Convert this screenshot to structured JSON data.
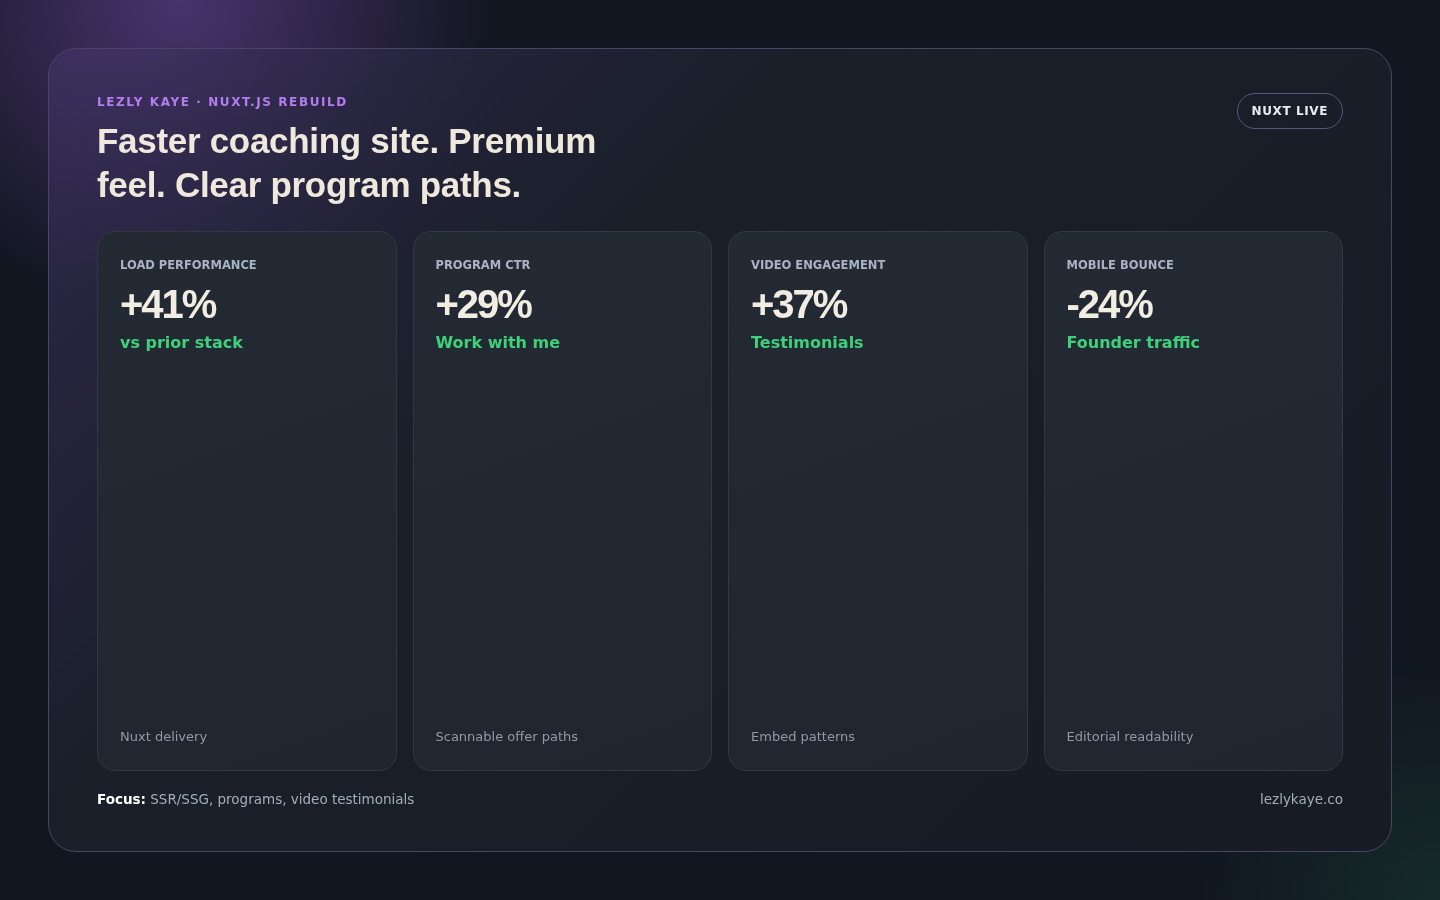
{
  "eyebrow": "LEZLY KAYE · NUXT.JS REBUILD",
  "title": "Faster coaching site. Premium feel. Clear program paths.",
  "badge": "NUXT LIVE",
  "metrics": [
    {
      "label": "LOAD PERFORMANCE",
      "value": "+41%",
      "note": "vs prior stack",
      "footer": "Nuxt delivery"
    },
    {
      "label": "PROGRAM CTR",
      "value": "+29%",
      "note": "Work with me",
      "footer": "Scannable offer paths"
    },
    {
      "label": "VIDEO ENGAGEMENT",
      "value": "+37%",
      "note": "Testimonials",
      "footer": "Embed patterns"
    },
    {
      "label": "MOBILE BOUNCE",
      "value": "-24%",
      "note": "Founder traffic",
      "footer": "Editorial readability"
    }
  ],
  "focus": "**Focus:** SSR/SSG, programs, video testimonials",
  "site": "lezlykaye.co"
}
